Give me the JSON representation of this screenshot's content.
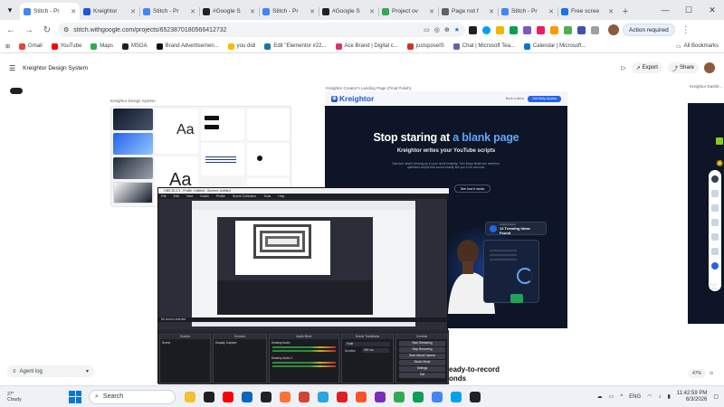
{
  "browser": {
    "tabs": [
      {
        "title": "Stitch - Pr",
        "fav": "#4285f4",
        "active": true
      },
      {
        "title": "Kreightor",
        "fav": "#1e56d9"
      },
      {
        "title": "Stitch - Pr",
        "fav": "#4285f4"
      },
      {
        "title": "#Google S",
        "fav": "#202124"
      },
      {
        "title": "Stitch - Pr",
        "fav": "#4285f4"
      },
      {
        "title": "#Google S",
        "fav": "#202124"
      },
      {
        "title": "Project ov",
        "fav": "#34a853"
      },
      {
        "title": "Page not f",
        "fav": "#5f6368"
      },
      {
        "title": "Stitch - Pr",
        "fav": "#4285f4"
      },
      {
        "title": "Free scree",
        "fav": "#1a73e8"
      }
    ],
    "new_tab": "+",
    "url": "stitch.withgoogle.com/projects/6523870180566412732",
    "action_required": "Action required",
    "bookmarks": [
      {
        "label": "Gmail",
        "color": "#ea4335"
      },
      {
        "label": "YouTube",
        "color": "#ff0000"
      },
      {
        "label": "Maps",
        "color": "#34a853"
      },
      {
        "label": "MSGA",
        "color": "#202124"
      },
      {
        "label": "Brand Advertisemen...",
        "color": "#111111"
      },
      {
        "label": "you didi",
        "color": "#fbbc04"
      },
      {
        "label": "Edit \"Elementor #22...",
        "color": "#21759b"
      },
      {
        "label": "Ace Brand | Digital c...",
        "color": "#e1306c"
      },
      {
        "label": "justsposeIS",
        "color": "#d93025"
      },
      {
        "label": "Chat | Microsoft Tea...",
        "color": "#6264a7"
      },
      {
        "label": "Calendar | Microsoft...",
        "color": "#0078d4"
      }
    ],
    "all_bookmarks": "All Bookmarks"
  },
  "app": {
    "project_title": "Kreightor Design System",
    "share_label": "Share",
    "export_label": "Export"
  },
  "canvas": {
    "ds_board_label": "Kreightor Design System",
    "ds_aa": "Aa",
    "lp_board_label": "Kreightor Creator's Landing Page (Final Polish)",
    "rb_board_label": "Kreightor Dashb...",
    "landing": {
      "logo": "Kreightor",
      "nav_link": "Book a demo",
      "nav_cta": "Get Early Access",
      "headline_a": "Stop staring at ",
      "headline_b": "a blank page",
      "subheadline": "Kreightor writes your YouTube scripts",
      "body": "Discover what's blowing up in your niche instantly. Turn those ideas into retention-optimized scripts that sound exactly like you in 60 seconds.",
      "secondary_cta": "See how it works",
      "trend_small": "Insight Engine",
      "trend_big": "12 Trending Ideas Found",
      "ready_heading_1": "eady-to-record",
      "ready_heading_2": "onds"
    },
    "rb_subtext": "Script Editor"
  },
  "obs": {
    "title": "OBS 30.2.3 - Profile: Untitled - Scenes: Untitled",
    "menu": [
      "File",
      "Edit",
      "View",
      "Docks",
      "Profile",
      "Scene Collection",
      "Tools",
      "Help"
    ],
    "no_source": "No source selected",
    "docks": [
      "Scenes",
      "Sources",
      "Audio Mixer",
      "Scene Transitions",
      "Controls"
    ],
    "scene_item": "Scene",
    "source_item": "Display Capture",
    "mixer_items": [
      "Desktop Audio",
      "Desktop Audio 2"
    ],
    "transition": "Fade",
    "duration_label": "Duration",
    "duration_value": "300 ms",
    "controls": [
      "Start Streaming",
      "Stop Recording",
      "Start Virtual Camera",
      "Studio Mode",
      "Settings",
      "Exit"
    ]
  },
  "agent_log": "Agent log",
  "zoom": "47%",
  "taskbar": {
    "temp": "27°",
    "weather": "Cloudy",
    "search": "Search",
    "lang": "ENG",
    "time": "11:42:59 PM",
    "date": "6/3/2026"
  }
}
